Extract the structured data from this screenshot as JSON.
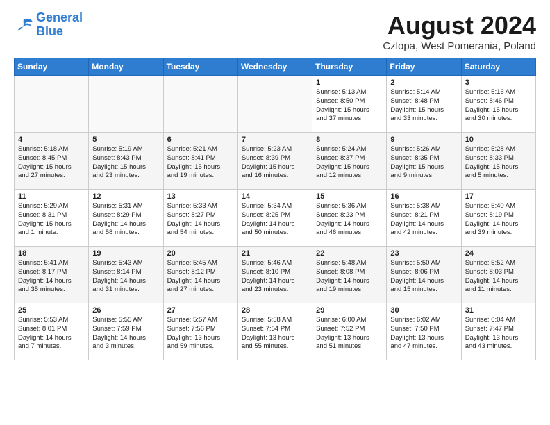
{
  "header": {
    "logo_line1": "General",
    "logo_line2": "Blue",
    "month": "August 2024",
    "location": "Czlopa, West Pomerania, Poland"
  },
  "days_of_week": [
    "Sunday",
    "Monday",
    "Tuesday",
    "Wednesday",
    "Thursday",
    "Friday",
    "Saturday"
  ],
  "weeks": [
    [
      {
        "day": "",
        "content": ""
      },
      {
        "day": "",
        "content": ""
      },
      {
        "day": "",
        "content": ""
      },
      {
        "day": "",
        "content": ""
      },
      {
        "day": "1",
        "content": "Sunrise: 5:13 AM\nSunset: 8:50 PM\nDaylight: 15 hours\nand 37 minutes."
      },
      {
        "day": "2",
        "content": "Sunrise: 5:14 AM\nSunset: 8:48 PM\nDaylight: 15 hours\nand 33 minutes."
      },
      {
        "day": "3",
        "content": "Sunrise: 5:16 AM\nSunset: 8:46 PM\nDaylight: 15 hours\nand 30 minutes."
      }
    ],
    [
      {
        "day": "4",
        "content": "Sunrise: 5:18 AM\nSunset: 8:45 PM\nDaylight: 15 hours\nand 27 minutes."
      },
      {
        "day": "5",
        "content": "Sunrise: 5:19 AM\nSunset: 8:43 PM\nDaylight: 15 hours\nand 23 minutes."
      },
      {
        "day": "6",
        "content": "Sunrise: 5:21 AM\nSunset: 8:41 PM\nDaylight: 15 hours\nand 19 minutes."
      },
      {
        "day": "7",
        "content": "Sunrise: 5:23 AM\nSunset: 8:39 PM\nDaylight: 15 hours\nand 16 minutes."
      },
      {
        "day": "8",
        "content": "Sunrise: 5:24 AM\nSunset: 8:37 PM\nDaylight: 15 hours\nand 12 minutes."
      },
      {
        "day": "9",
        "content": "Sunrise: 5:26 AM\nSunset: 8:35 PM\nDaylight: 15 hours\nand 9 minutes."
      },
      {
        "day": "10",
        "content": "Sunrise: 5:28 AM\nSunset: 8:33 PM\nDaylight: 15 hours\nand 5 minutes."
      }
    ],
    [
      {
        "day": "11",
        "content": "Sunrise: 5:29 AM\nSunset: 8:31 PM\nDaylight: 15 hours\nand 1 minute."
      },
      {
        "day": "12",
        "content": "Sunrise: 5:31 AM\nSunset: 8:29 PM\nDaylight: 14 hours\nand 58 minutes."
      },
      {
        "day": "13",
        "content": "Sunrise: 5:33 AM\nSunset: 8:27 PM\nDaylight: 14 hours\nand 54 minutes."
      },
      {
        "day": "14",
        "content": "Sunrise: 5:34 AM\nSunset: 8:25 PM\nDaylight: 14 hours\nand 50 minutes."
      },
      {
        "day": "15",
        "content": "Sunrise: 5:36 AM\nSunset: 8:23 PM\nDaylight: 14 hours\nand 46 minutes."
      },
      {
        "day": "16",
        "content": "Sunrise: 5:38 AM\nSunset: 8:21 PM\nDaylight: 14 hours\nand 42 minutes."
      },
      {
        "day": "17",
        "content": "Sunrise: 5:40 AM\nSunset: 8:19 PM\nDaylight: 14 hours\nand 39 minutes."
      }
    ],
    [
      {
        "day": "18",
        "content": "Sunrise: 5:41 AM\nSunset: 8:17 PM\nDaylight: 14 hours\nand 35 minutes."
      },
      {
        "day": "19",
        "content": "Sunrise: 5:43 AM\nSunset: 8:14 PM\nDaylight: 14 hours\nand 31 minutes."
      },
      {
        "day": "20",
        "content": "Sunrise: 5:45 AM\nSunset: 8:12 PM\nDaylight: 14 hours\nand 27 minutes."
      },
      {
        "day": "21",
        "content": "Sunrise: 5:46 AM\nSunset: 8:10 PM\nDaylight: 14 hours\nand 23 minutes."
      },
      {
        "day": "22",
        "content": "Sunrise: 5:48 AM\nSunset: 8:08 PM\nDaylight: 14 hours\nand 19 minutes."
      },
      {
        "day": "23",
        "content": "Sunrise: 5:50 AM\nSunset: 8:06 PM\nDaylight: 14 hours\nand 15 minutes."
      },
      {
        "day": "24",
        "content": "Sunrise: 5:52 AM\nSunset: 8:03 PM\nDaylight: 14 hours\nand 11 minutes."
      }
    ],
    [
      {
        "day": "25",
        "content": "Sunrise: 5:53 AM\nSunset: 8:01 PM\nDaylight: 14 hours\nand 7 minutes."
      },
      {
        "day": "26",
        "content": "Sunrise: 5:55 AM\nSunset: 7:59 PM\nDaylight: 14 hours\nand 3 minutes."
      },
      {
        "day": "27",
        "content": "Sunrise: 5:57 AM\nSunset: 7:56 PM\nDaylight: 13 hours\nand 59 minutes."
      },
      {
        "day": "28",
        "content": "Sunrise: 5:58 AM\nSunset: 7:54 PM\nDaylight: 13 hours\nand 55 minutes."
      },
      {
        "day": "29",
        "content": "Sunrise: 6:00 AM\nSunset: 7:52 PM\nDaylight: 13 hours\nand 51 minutes."
      },
      {
        "day": "30",
        "content": "Sunrise: 6:02 AM\nSunset: 7:50 PM\nDaylight: 13 hours\nand 47 minutes."
      },
      {
        "day": "31",
        "content": "Sunrise: 6:04 AM\nSunset: 7:47 PM\nDaylight: 13 hours\nand 43 minutes."
      }
    ]
  ]
}
